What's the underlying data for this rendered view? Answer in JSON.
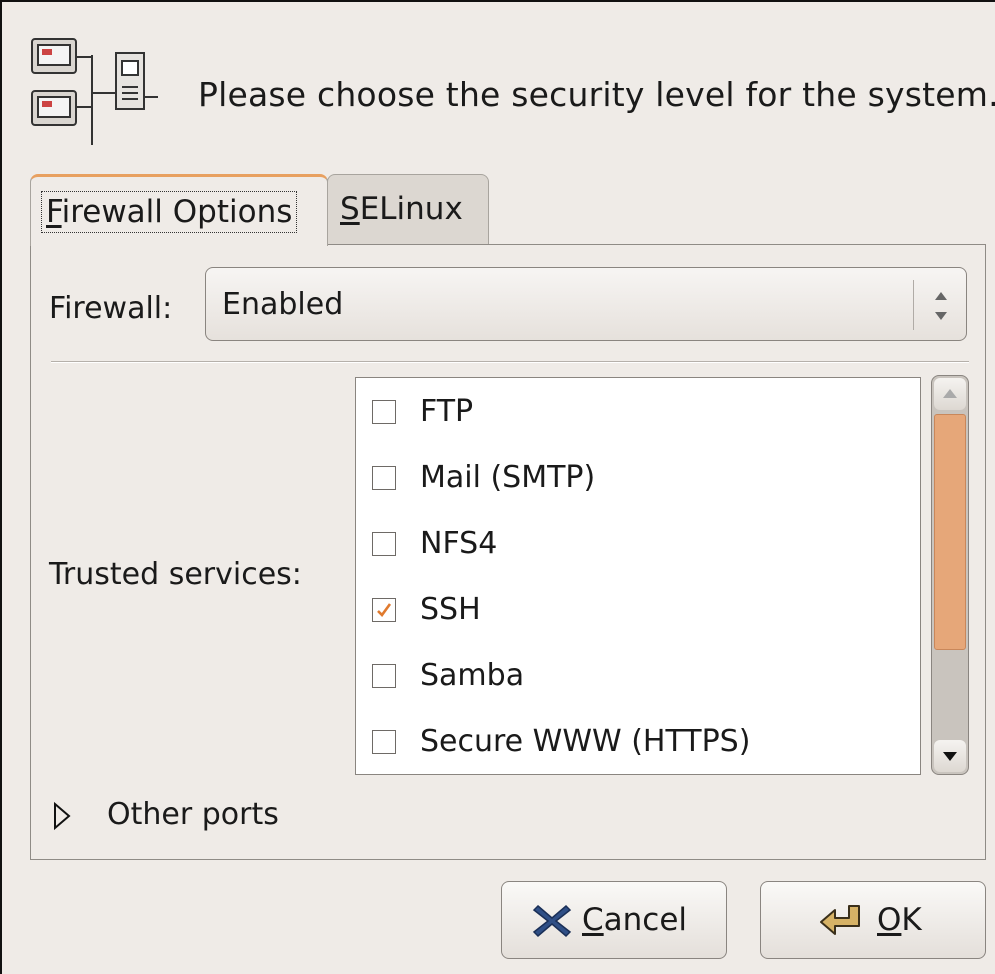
{
  "header": {
    "text": "Please choose the security level for the system.",
    "icon": "network-firewall-icon"
  },
  "tabs": [
    {
      "mnemonic": "F",
      "rest": "irewall Options",
      "selected": true
    },
    {
      "mnemonic": "S",
      "rest": "ELinux",
      "selected": false
    }
  ],
  "firewall": {
    "label": "Firewall:",
    "value": "Enabled"
  },
  "trusted_services": {
    "label": "Trusted services:",
    "items": [
      {
        "name": "FTP",
        "checked": false
      },
      {
        "name": "Mail (SMTP)",
        "checked": false
      },
      {
        "name": "NFS4",
        "checked": false
      },
      {
        "name": "SSH",
        "checked": true
      },
      {
        "name": "Samba",
        "checked": false
      },
      {
        "name": "Secure WWW (HTTPS)",
        "checked": false
      }
    ]
  },
  "other_ports": {
    "label": "Other ports"
  },
  "buttons": {
    "cancel": {
      "mnemonic": "C",
      "rest": "ancel",
      "icon": "cancel-x-icon"
    },
    "ok": {
      "mnemonic": "O",
      "rest": "K",
      "icon": "ok-return-arrow-icon"
    }
  },
  "colors": {
    "accent": "#e8a060",
    "check": "#e07a2e",
    "window_bg": "#efebe7"
  }
}
